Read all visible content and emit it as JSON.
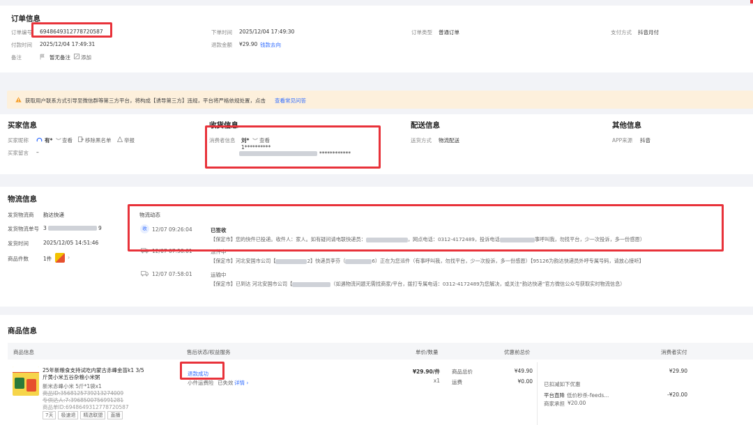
{
  "order_info": {
    "title": "订单信息",
    "order_no_label": "订单编号",
    "order_no": "6948649312778720587",
    "order_time_label": "下单时间",
    "order_time": "2025/12/04 17:49:30",
    "order_type_label": "订单类型",
    "order_type": "普通订单",
    "pay_method_label": "支付方式",
    "pay_method": "抖音月付",
    "pay_time_label": "付款时间",
    "pay_time": "2025/12/04 17:49:31",
    "refund_label": "退款金额",
    "refund_amount": "¥29.90",
    "refund_link": "钱款去向",
    "remark_label": "备注",
    "remark_value": "暂无备注",
    "remark_add": "添加"
  },
  "notice": {
    "text": "获取用户联系方式引导至微信群等第三方平台，将构成【诱导第三方】违规，平台将严格依规处置，点击",
    "link": "查看常见问答"
  },
  "buyer": {
    "title": "买家信息",
    "nick_label": "买家昵称",
    "nick": "有*",
    "view": "查看",
    "blacklist": "移除黑名单",
    "report": "举报",
    "msg_label": "买家留言",
    "msg": "–"
  },
  "receiver": {
    "title": "收货信息",
    "consumer_label": "消费者信息",
    "name": "刘*",
    "view": "查看",
    "phone": "1**********",
    "address_mask": "************"
  },
  "delivery": {
    "title": "配送信息",
    "method_label": "送货方式",
    "method": "物流配送"
  },
  "other": {
    "title": "其他信息",
    "app_label": "APP来源",
    "app": "抖音"
  },
  "logistics": {
    "title": "物流信息",
    "company_label": "发货物流商",
    "company": "韵达快递",
    "tracking_label": "发货物流单号",
    "tracking_prefix": "3",
    "tracking_suffix": "9",
    "ship_time_label": "发货时间",
    "ship_time": "2025/12/05 14:51:46",
    "items_label": "商品件数",
    "items": "1件",
    "dynamic_title": "物流动态",
    "events": [
      {
        "icon": "收",
        "time": "12/07 09:26:04",
        "status": "已签收",
        "detail": "【保定市】您的快件已投递。收件人：家人。如有疑问请电联快递员：",
        "detail2": "，网点电话：0312-4172489，投诉电话",
        "detail3": "事呼叫我，勿找平台，少一次投诉，多一份感恩）"
      },
      {
        "icon": "truck-icon",
        "time": "12/07 07:58:01",
        "status": "派件中",
        "detail": "【保定市】河北安国市公司【",
        "detail2": "2】快递员李芬（",
        "detail3": "6）正在为您派件（有事呼叫我，勿找平台，少一次投诉，多一份感恩）【95126为韵达快递员外呼专属号码，请放心接听】"
      },
      {
        "icon": "truck-icon",
        "time": "12/07 07:58:01",
        "status": "运输中",
        "detail": "【保定市】已到达 河北安国市公司【",
        "detail2": "（如遇物流问题无需找商家/平台，拨打专属电话：0312-4172489为您解决，或关注“韵达快递”官方微信公众号获取实时物流信息）",
        "detail3": ""
      }
    ]
  },
  "goods": {
    "title": "商品信息",
    "headers": {
      "product": "商品信息",
      "after_sale": "售后状态/权益服务",
      "price_qty": "单价/数量",
      "discount_total": "优惠前总价",
      "paid": "消费者实付"
    },
    "product_name": "25年新粮食支持试吃内蒙古赤峰金苗k1 3/5斤黄小米五谷杂粮小米粥",
    "product_spec": "新米赤峰小米 5斤*1袋x1",
    "product_id": "商品ID:3568125739213274009",
    "sku_code": "专供达人:7:3968500756991281",
    "order_code": "商品单ID:6948649312778720587",
    "tags": [
      "7天",
      "极速退",
      "精选联盟",
      "直播"
    ],
    "refund_status": "退款成功",
    "rights_text": "小件运费险",
    "rights_status": "已失效",
    "rights_link": "详情",
    "unit_price": "¥29.90/件",
    "qty": "x1",
    "total_label": "商品总价",
    "total": "¥49.90",
    "freight_label": "运费",
    "freight": "¥0.00",
    "paid": "¥29.90",
    "discount_title": "已扣减如下优惠",
    "platform_label": "平台直降",
    "platform_desc": "低价秒杀-feeds...",
    "platform_amount": "-¥20.00",
    "merchant_label": "商家承担",
    "merchant_amount": "¥20.00"
  },
  "colors": {
    "accent": "#2f6bff",
    "highlight_box": "#e8323a",
    "notice_bg": "#fdf0dc",
    "warning_icon": "#f7a02c"
  }
}
